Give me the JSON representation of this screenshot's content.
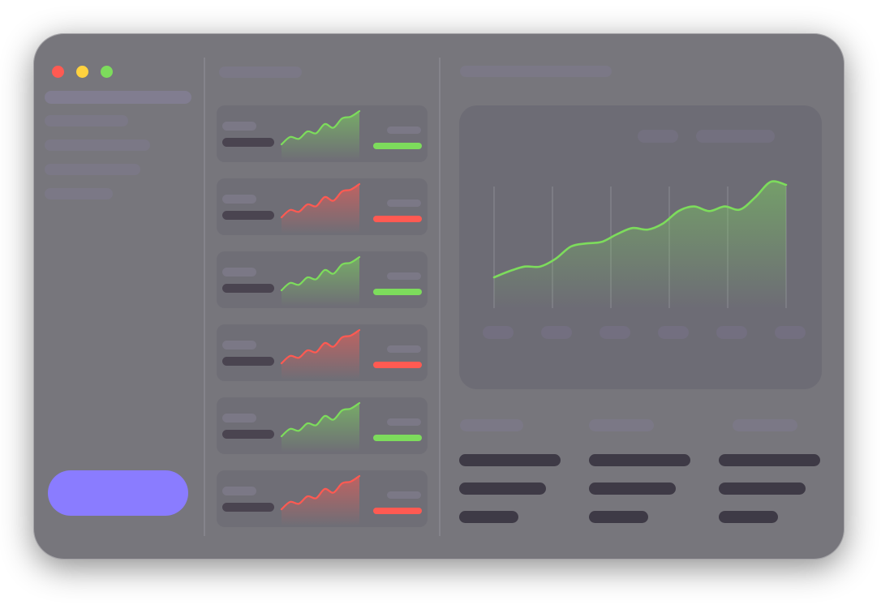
{
  "window": {
    "controls": [
      {
        "name": "close",
        "color": "#ff5a52"
      },
      {
        "name": "minimize",
        "color": "#ffd23f"
      },
      {
        "name": "zoom",
        "color": "#7ddc5c"
      }
    ]
  },
  "colors": {
    "background": "#77767c",
    "placeholder": "#7b7886",
    "dark_bar": "#3e3a46",
    "accent_button": "#8a7cff",
    "positive": "#7ddc5c",
    "negative": "#ff5a52"
  },
  "watchlist": {
    "cards": [
      {
        "trend": "up",
        "values": [
          3,
          7,
          6,
          10,
          9,
          14,
          12,
          17,
          18,
          21
        ]
      },
      {
        "trend": "down",
        "values": [
          3,
          7,
          6,
          10,
          9,
          14,
          12,
          17,
          18,
          21
        ]
      },
      {
        "trend": "up",
        "values": [
          3,
          7,
          6,
          10,
          9,
          14,
          12,
          17,
          18,
          21
        ]
      },
      {
        "trend": "down",
        "values": [
          3,
          7,
          6,
          10,
          9,
          14,
          12,
          17,
          18,
          21
        ]
      },
      {
        "trend": "up",
        "values": [
          3,
          7,
          6,
          10,
          9,
          14,
          12,
          17,
          18,
          21
        ]
      },
      {
        "trend": "down",
        "values": [
          3,
          7,
          6,
          10,
          9,
          14,
          12,
          17,
          18,
          21
        ]
      }
    ]
  },
  "chart_data": {
    "type": "area",
    "x": [
      0,
      1,
      2,
      3,
      4,
      5,
      6,
      7,
      8,
      9,
      10,
      11,
      12,
      13,
      14,
      15,
      16,
      17,
      18,
      19
    ],
    "series": [
      {
        "values": [
          20,
          24,
          27,
          27,
          32,
          40,
          42,
          43,
          48,
          52,
          51,
          55,
          63,
          66,
          63,
          66,
          64,
          72,
          82,
          80
        ]
      }
    ],
    "ylim": [
      0,
      100
    ],
    "grid": true,
    "title": "",
    "xlabel": "",
    "ylabel": ""
  }
}
